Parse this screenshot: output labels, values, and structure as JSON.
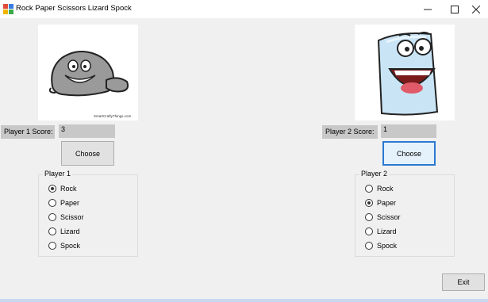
{
  "window": {
    "title": "Rock Paper Scissors Lizard Spock",
    "minimize_icon": "minimize-icon",
    "maximize_icon": "maximize-icon",
    "close_icon": "close-icon"
  },
  "player1": {
    "image_icon": "cartoon-rock",
    "image_caption": "SmartCraftyThings.com",
    "score_label": "Player 1 Score:",
    "score_value": "3",
    "choose_label": "Choose",
    "group_label": "Player 1",
    "options": [
      {
        "label": "Rock",
        "checked": true
      },
      {
        "label": "Paper",
        "checked": false
      },
      {
        "label": "Scissor",
        "checked": false
      },
      {
        "label": "Lizard",
        "checked": false
      },
      {
        "label": "Spock",
        "checked": false
      }
    ]
  },
  "player2": {
    "image_icon": "cartoon-paper",
    "score_label": "Player 2 Score:",
    "score_value": "1",
    "choose_label": "Choose",
    "group_label": "Player 2",
    "options": [
      {
        "label": "Rock",
        "checked": false
      },
      {
        "label": "Paper",
        "checked": true
      },
      {
        "label": "Scissor",
        "checked": false
      },
      {
        "label": "Lizard",
        "checked": false
      },
      {
        "label": "Spock",
        "checked": false
      }
    ]
  },
  "exit_label": "Exit",
  "colors": {
    "focus_border": "#2b79d0",
    "label_bg": "#c8c8c8",
    "window_bg": "#f0f0f0"
  }
}
